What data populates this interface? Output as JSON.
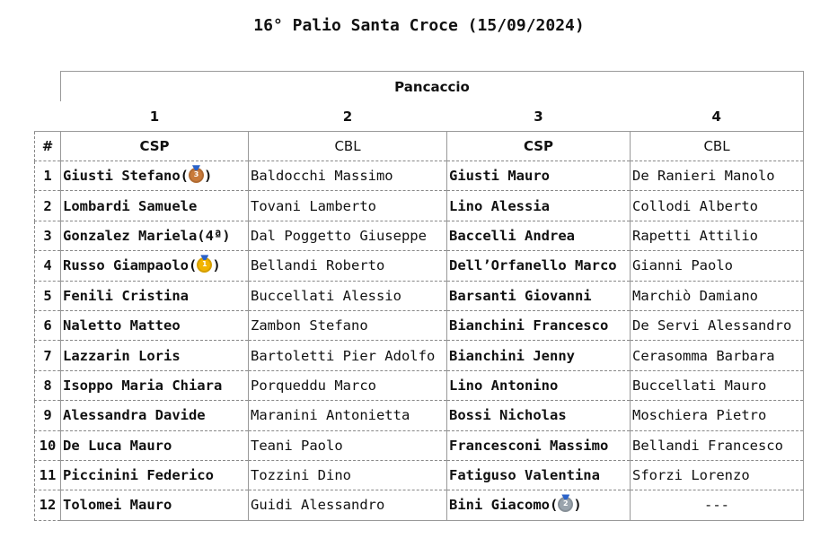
{
  "title": "16° Palio Santa Croce (15/09/2024)",
  "venue": "Pancaccio",
  "columns": [
    "1",
    "2",
    "3",
    "4"
  ],
  "hash_label": "#",
  "teams": [
    "CSP",
    "CBL",
    "CSP",
    "CBL"
  ],
  "medal_colors": {
    "gold": "#f2b400",
    "silver": "#9aa4ad",
    "bronze": "#c97a3a"
  },
  "rows": [
    {
      "n": "1",
      "c1": "Giusti Stefano(",
      "m1": "bronze-medal-icon",
      "d1": "3",
      "c1_end": ")",
      "c2": "Baldocchi Massimo",
      "c3": "Giusti Mauro",
      "c4": "De Ranieri Manolo"
    },
    {
      "n": "2",
      "c1": "Lombardi Samuele",
      "c2": "Tovani Lamberto",
      "c3": "Lino Alessia",
      "c4": "Collodi Alberto"
    },
    {
      "n": "3",
      "c1": "Gonzalez Mariela(4ª)",
      "c2": "Dal Poggetto Giuseppe",
      "c3": "Baccelli Andrea",
      "c4": "Rapetti Attilio"
    },
    {
      "n": "4",
      "c1": "Russo Giampaolo(",
      "m1": "gold-medal-icon",
      "d1": "1",
      "c1_end": ")",
      "c2": "Bellandi Roberto",
      "c3": "Dell’Orfanello Marco",
      "c4": "Gianni Paolo"
    },
    {
      "n": "5",
      "c1": "Fenili Cristina",
      "c2": "Buccellati Alessio",
      "c3": "Barsanti Giovanni",
      "c4": "Marchiò Damiano"
    },
    {
      "n": "6",
      "c1": "Naletto Matteo",
      "c2": "Zambon Stefano",
      "c3": "Bianchini Francesco",
      "c4": "De Servi Alessandro"
    },
    {
      "n": "7",
      "c1": "Lazzarin Loris",
      "c2": "Bartoletti Pier Adolfo",
      "c3": "Bianchini Jenny",
      "c4": "Cerasomma Barbara"
    },
    {
      "n": "8",
      "c1": "Isoppo Maria Chiara",
      "c2": "Porqueddu Marco",
      "c3": "Lino Antonino",
      "c4": "Buccellati Mauro"
    },
    {
      "n": "9",
      "c1": "Alessandra Davide",
      "c2": "Maranini Antonietta",
      "c3": "Bossi Nicholas",
      "c4": "Moschiera Pietro"
    },
    {
      "n": "10",
      "c1": "De Luca Mauro",
      "c2": "Teani Paolo",
      "c3": "Francesconi Massimo",
      "c4": "Bellandi Francesco"
    },
    {
      "n": "11",
      "c1": "Piccinini Federico",
      "c2": "Tozzini Dino",
      "c3": "Fatiguso Valentina",
      "c4": "Sforzi Lorenzo"
    },
    {
      "n": "12",
      "c1": "Tolomei Mauro",
      "c2": "Guidi Alessandro",
      "c3": "Bini Giacomo(",
      "m3": "silver-medal-icon",
      "d3": "2",
      "c3_end": ")",
      "c4": "---"
    }
  ]
}
